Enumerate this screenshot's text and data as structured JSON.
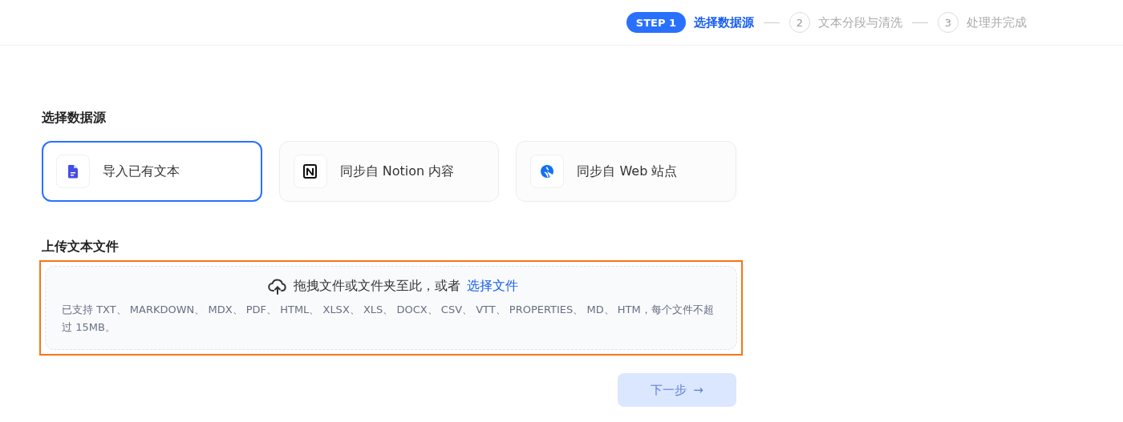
{
  "steps": [
    {
      "badge": "STEP 1",
      "label": "选择数据源",
      "selected": true
    },
    {
      "badge": "2",
      "label": "文本分段与清洗",
      "selected": false
    },
    {
      "badge": "3",
      "label": "处理并完成",
      "selected": false
    }
  ],
  "source_title": "选择数据源",
  "sources": [
    {
      "kind": "file",
      "label": "导入已有文本",
      "selected": true
    },
    {
      "kind": "notion",
      "label": "同步自 Notion 内容",
      "selected": false
    },
    {
      "kind": "web",
      "label": "同步自 Web 站点",
      "selected": false
    }
  ],
  "upload": {
    "title": "上传文本文件",
    "highlighted": true,
    "prompt": "拖拽文件或文件夹至此，或者",
    "link": "选择文件",
    "hint": "已支持 TXT、 MARKDOWN、 MDX、 PDF、 HTML、 XLSX、 XLS、 DOCX、 CSV、 VTT、 PROPERTIES、 MD、 HTM，每个文件不超过 15MB。"
  },
  "next_button": {
    "label": "下一步",
    "arrow": "→",
    "disabled": true
  }
}
